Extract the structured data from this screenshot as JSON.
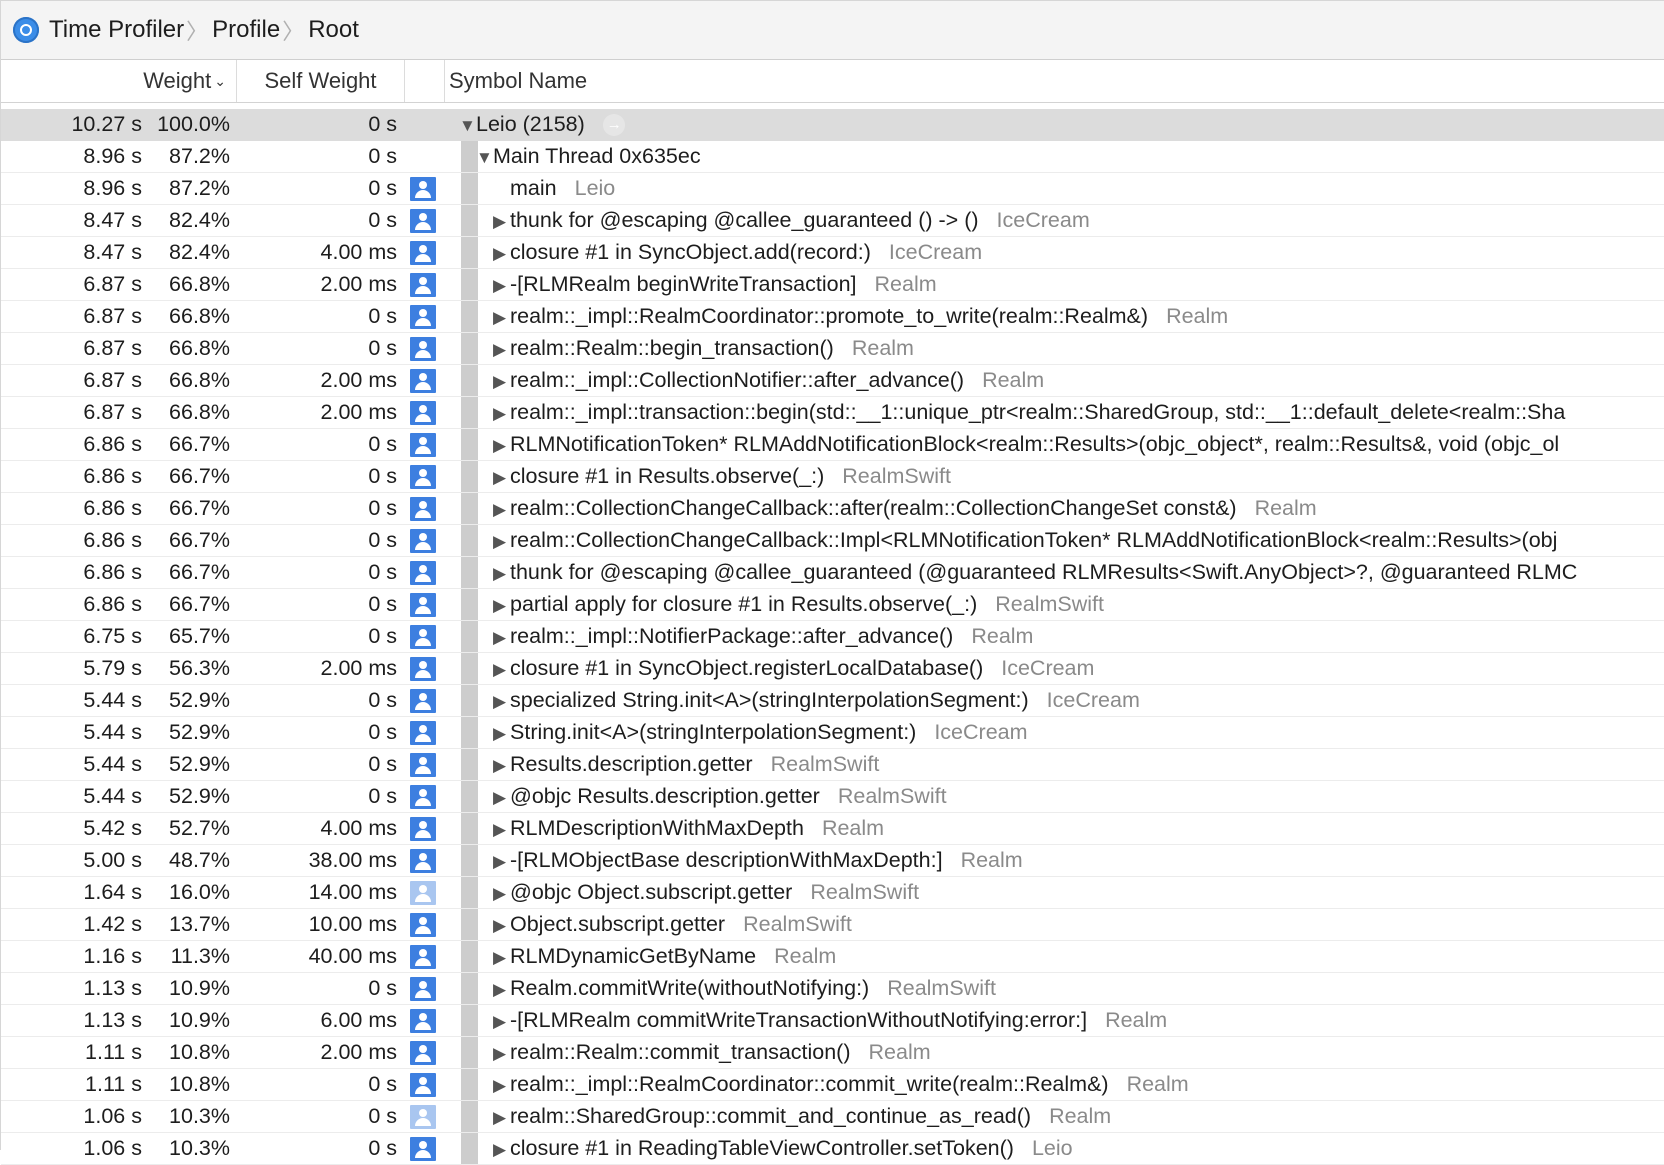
{
  "breadcrumb": {
    "items": [
      "Time Profiler",
      "Profile",
      "Root"
    ]
  },
  "columns": {
    "weight": "Weight",
    "self_weight": "Self Weight",
    "symbol_name": "Symbol Name"
  },
  "icons": {
    "app": "time-profiler-icon",
    "user_code": "user-code-icon",
    "focus_arrow": "focus-arrow-icon"
  },
  "colors": {
    "accent": "#3d7fe0",
    "selection": "#dcdcdc",
    "library_text": "#8a8a8a"
  },
  "rows": [
    {
      "weight": "10.27 s",
      "percent": "100.0%",
      "self": "0 s",
      "icon": "none",
      "expander": "down",
      "symbol": "Leio (2158)",
      "library": "",
      "selected": true,
      "go": true,
      "indent": 0
    },
    {
      "weight": "8.96 s",
      "percent": "87.2%",
      "self": "0 s",
      "icon": "none",
      "expander": "down",
      "symbol": "Main Thread  0x635ec",
      "library": "",
      "indent": 1
    },
    {
      "weight": "8.96 s",
      "percent": "87.2%",
      "self": "0 s",
      "icon": "user",
      "expander": "none",
      "symbol": "main",
      "library": "Leio",
      "indent": 2
    },
    {
      "weight": "8.47 s",
      "percent": "82.4%",
      "self": "0 s",
      "icon": "user",
      "expander": "right",
      "symbol": "thunk for @escaping @callee_guaranteed () -> ()",
      "library": "IceCream",
      "indent": 2
    },
    {
      "weight": "8.47 s",
      "percent": "82.4%",
      "self": "4.00 ms",
      "icon": "user",
      "expander": "right",
      "symbol": "closure #1 in SyncObject.add(record:)",
      "library": "IceCream",
      "indent": 2
    },
    {
      "weight": "6.87 s",
      "percent": "66.8%",
      "self": "2.00 ms",
      "icon": "user",
      "expander": "right",
      "symbol": "-[RLMRealm beginWriteTransaction]",
      "library": "Realm",
      "indent": 2
    },
    {
      "weight": "6.87 s",
      "percent": "66.8%",
      "self": "0 s",
      "icon": "user",
      "expander": "right",
      "symbol": "realm::_impl::RealmCoordinator::promote_to_write(realm::Realm&)",
      "library": "Realm",
      "indent": 2
    },
    {
      "weight": "6.87 s",
      "percent": "66.8%",
      "self": "0 s",
      "icon": "user",
      "expander": "right",
      "symbol": "realm::Realm::begin_transaction()",
      "library": "Realm",
      "indent": 2
    },
    {
      "weight": "6.87 s",
      "percent": "66.8%",
      "self": "2.00 ms",
      "icon": "user",
      "expander": "right",
      "symbol": "realm::_impl::CollectionNotifier::after_advance()",
      "library": "Realm",
      "indent": 2
    },
    {
      "weight": "6.87 s",
      "percent": "66.8%",
      "self": "2.00 ms",
      "icon": "user",
      "expander": "right",
      "symbol": "realm::_impl::transaction::begin(std::__1::unique_ptr<realm::SharedGroup, std::__1::default_delete<realm::Sha",
      "library": "",
      "indent": 2
    },
    {
      "weight": "6.86 s",
      "percent": "66.7%",
      "self": "0 s",
      "icon": "user",
      "expander": "right",
      "symbol": "RLMNotificationToken* RLMAddNotificationBlock<realm::Results>(objc_object*, realm::Results&, void (objc_ol",
      "library": "",
      "indent": 2
    },
    {
      "weight": "6.86 s",
      "percent": "66.7%",
      "self": "0 s",
      "icon": "user",
      "expander": "right",
      "symbol": "closure #1 in Results.observe(_:)",
      "library": "RealmSwift",
      "indent": 2
    },
    {
      "weight": "6.86 s",
      "percent": "66.7%",
      "self": "0 s",
      "icon": "user",
      "expander": "right",
      "symbol": "realm::CollectionChangeCallback::after(realm::CollectionChangeSet const&)",
      "library": "Realm",
      "indent": 2
    },
    {
      "weight": "6.86 s",
      "percent": "66.7%",
      "self": "0 s",
      "icon": "user",
      "expander": "right",
      "symbol": "realm::CollectionChangeCallback::Impl<RLMNotificationToken* RLMAddNotificationBlock<realm::Results>(obj",
      "library": "",
      "indent": 2
    },
    {
      "weight": "6.86 s",
      "percent": "66.7%",
      "self": "0 s",
      "icon": "user",
      "expander": "right",
      "symbol": "thunk for @escaping @callee_guaranteed (@guaranteed RLMResults<Swift.AnyObject>?, @guaranteed RLMC",
      "library": "",
      "indent": 2
    },
    {
      "weight": "6.86 s",
      "percent": "66.7%",
      "self": "0 s",
      "icon": "user",
      "expander": "right",
      "symbol": "partial apply for closure #1 in Results.observe(_:)",
      "library": "RealmSwift",
      "indent": 2
    },
    {
      "weight": "6.75 s",
      "percent": "65.7%",
      "self": "0 s",
      "icon": "user",
      "expander": "right",
      "symbol": "realm::_impl::NotifierPackage::after_advance()",
      "library": "Realm",
      "indent": 2
    },
    {
      "weight": "5.79 s",
      "percent": "56.3%",
      "self": "2.00 ms",
      "icon": "user",
      "expander": "right",
      "symbol": "closure #1 in SyncObject.registerLocalDatabase()",
      "library": "IceCream",
      "indent": 2
    },
    {
      "weight": "5.44 s",
      "percent": "52.9%",
      "self": "0 s",
      "icon": "user",
      "expander": "right",
      "symbol": "specialized String.init<A>(stringInterpolationSegment:)",
      "library": "IceCream",
      "indent": 2
    },
    {
      "weight": "5.44 s",
      "percent": "52.9%",
      "self": "0 s",
      "icon": "user",
      "expander": "right",
      "symbol": "String.init<A>(stringInterpolationSegment:)",
      "library": "IceCream",
      "indent": 2
    },
    {
      "weight": "5.44 s",
      "percent": "52.9%",
      "self": "0 s",
      "icon": "user",
      "expander": "right",
      "symbol": "Results.description.getter",
      "library": "RealmSwift",
      "indent": 2
    },
    {
      "weight": "5.44 s",
      "percent": "52.9%",
      "self": "0 s",
      "icon": "user",
      "expander": "right",
      "symbol": "@objc Results.description.getter",
      "library": "RealmSwift",
      "indent": 2
    },
    {
      "weight": "5.42 s",
      "percent": "52.7%",
      "self": "4.00 ms",
      "icon": "user",
      "expander": "right",
      "symbol": "RLMDescriptionWithMaxDepth",
      "library": "Realm",
      "indent": 2
    },
    {
      "weight": "5.00 s",
      "percent": "48.7%",
      "self": "38.00 ms",
      "icon": "user",
      "expander": "right",
      "symbol": "-[RLMObjectBase descriptionWithMaxDepth:]",
      "library": "Realm",
      "indent": 2
    },
    {
      "weight": "1.64 s",
      "percent": "16.0%",
      "self": "14.00 ms",
      "icon": "user-light",
      "expander": "right",
      "symbol": "@objc Object.subscript.getter",
      "library": "RealmSwift",
      "indent": 2
    },
    {
      "weight": "1.42 s",
      "percent": "13.7%",
      "self": "10.00 ms",
      "icon": "user",
      "expander": "right",
      "symbol": "Object.subscript.getter",
      "library": "RealmSwift",
      "indent": 2
    },
    {
      "weight": "1.16 s",
      "percent": "11.3%",
      "self": "40.00 ms",
      "icon": "user",
      "expander": "right",
      "symbol": "RLMDynamicGetByName",
      "library": "Realm",
      "indent": 2
    },
    {
      "weight": "1.13 s",
      "percent": "10.9%",
      "self": "0 s",
      "icon": "user",
      "expander": "right",
      "symbol": "Realm.commitWrite(withoutNotifying:)",
      "library": "RealmSwift",
      "indent": 2
    },
    {
      "weight": "1.13 s",
      "percent": "10.9%",
      "self": "6.00 ms",
      "icon": "user",
      "expander": "right",
      "symbol": "-[RLMRealm commitWriteTransactionWithoutNotifying:error:]",
      "library": "Realm",
      "indent": 2
    },
    {
      "weight": "1.11 s",
      "percent": "10.8%",
      "self": "2.00 ms",
      "icon": "user",
      "expander": "right",
      "symbol": "realm::Realm::commit_transaction()",
      "library": "Realm",
      "indent": 2
    },
    {
      "weight": "1.11 s",
      "percent": "10.8%",
      "self": "0 s",
      "icon": "user",
      "expander": "right",
      "symbol": "realm::_impl::RealmCoordinator::commit_write(realm::Realm&)",
      "library": "Realm",
      "indent": 2
    },
    {
      "weight": "1.06 s",
      "percent": "10.3%",
      "self": "0 s",
      "icon": "user-light",
      "expander": "right",
      "symbol": "realm::SharedGroup::commit_and_continue_as_read()",
      "library": "Realm",
      "indent": 2
    },
    {
      "weight": "1.06 s",
      "percent": "10.3%",
      "self": "0 s",
      "icon": "user",
      "expander": "right",
      "symbol": "closure #1 in ReadingTableViewController.setToken()",
      "library": "Leio",
      "indent": 2
    }
  ]
}
